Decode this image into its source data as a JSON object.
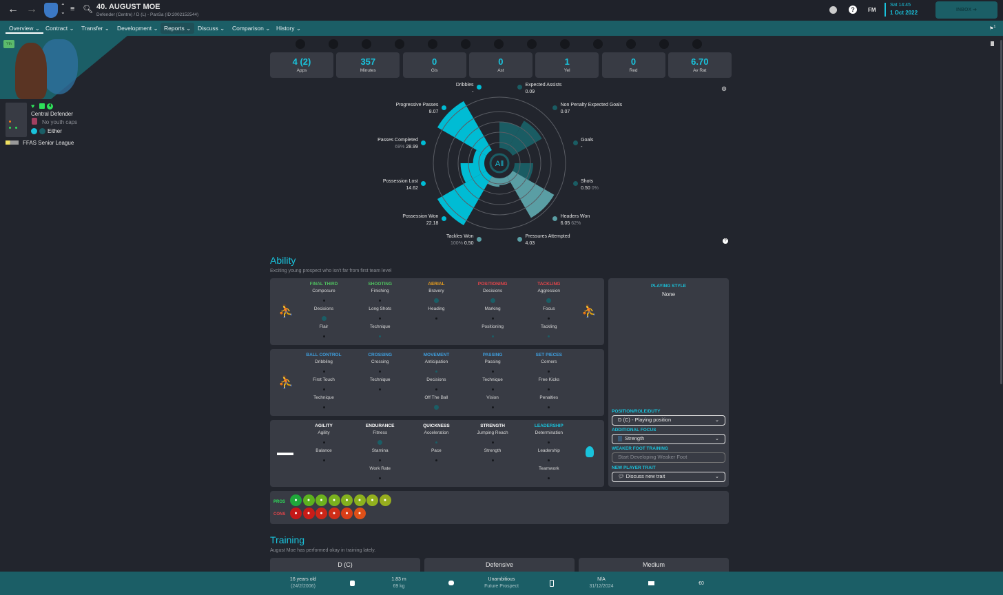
{
  "header": {
    "title": "40. AUGUST MOE",
    "subtitle": "Defender (Centre) / D (L) - PanSa (ID:2002152544)",
    "day_time": "Sat 14:45",
    "date": "1 Oct 2022",
    "inbox": "INBOX",
    "fm": "FM",
    "notif_count": "1"
  },
  "nav": [
    {
      "label": "Overview"
    },
    {
      "label": "Contract"
    },
    {
      "label": "Transfer"
    },
    {
      "label": "Development"
    },
    {
      "label": "Reports"
    },
    {
      "label": "Discuss"
    },
    {
      "label": "Comparison"
    },
    {
      "label": "History"
    }
  ],
  "profile": {
    "badge": "Yth",
    "position": "Central Defender",
    "youth_caps": "No youth caps",
    "foot": "Either",
    "league": "FFAS Senior League",
    "morale_num": "4"
  },
  "stats": [
    {
      "value": "4 (2)",
      "label": "Apps"
    },
    {
      "value": "357",
      "label": "Minutes"
    },
    {
      "value": "0",
      "label": "Gls"
    },
    {
      "value": "0",
      "label": "Ast"
    },
    {
      "value": "1",
      "label": "Yel"
    },
    {
      "value": "0",
      "label": "Red"
    },
    {
      "value": "6.70",
      "label": "Av Rat"
    }
  ],
  "chart_data": {
    "type": "radar-polar",
    "center_label": "All",
    "items": [
      {
        "name": "Dribbles",
        "value": "-",
        "extra": "",
        "level": 0,
        "color": "#00bcd4"
      },
      {
        "name": "Expected Assists",
        "value": "0.09",
        "extra": "",
        "level": 0.47,
        "color": "#1a5c63"
      },
      {
        "name": "Non Penalty Expected Goals",
        "value": "0.07",
        "extra": "",
        "level": 0.6,
        "color": "#1a5c63"
      },
      {
        "name": "Goals",
        "value": "-",
        "extra": "",
        "level": 0,
        "color": "#1a5c63"
      },
      {
        "name": "Shots",
        "value": "0.50",
        "extra": "0%",
        "level": 0.33,
        "color": "#1a5c63"
      },
      {
        "name": "Headers Won",
        "value": "6.05",
        "extra": "62%",
        "level": 0.85,
        "color": "#5a9ea4"
      },
      {
        "name": "Pressures Attempted",
        "value": "4.03",
        "extra": "",
        "level": 0.12,
        "color": "#5a9ea4"
      },
      {
        "name": "Tackles Won",
        "value": "0.50",
        "extra": "100%",
        "level": 0.15,
        "color": "#5a9ea4"
      },
      {
        "name": "Possession Won",
        "value": "22.18",
        "extra": "",
        "level": 1.0,
        "color": "#00bcd4"
      },
      {
        "name": "Possession Lost",
        "value": "14.62",
        "extra": "",
        "level": 0.42,
        "color": "#00bcd4"
      },
      {
        "name": "Passes Completed",
        "value": "28.99",
        "extra": "69%",
        "level": 0.2,
        "color": "#00bcd4"
      },
      {
        "name": "Progressive Passes",
        "value": "8.07",
        "extra": "",
        "level": 1.0,
        "color": "#00bcd4"
      }
    ]
  },
  "ability": {
    "title": "Ability",
    "subtitle": "Exciting young prospect who isn't far from first team level",
    "groups": [
      [
        {
          "h": "FINAL THIRD",
          "c": "#4fc15f",
          "a": [
            "Composure",
            "Decisions",
            "Flair"
          ],
          "d": [
            "s",
            "b",
            "s"
          ]
        },
        {
          "h": "SHOOTING",
          "c": "#4fc15f",
          "a": [
            "Finishing",
            "Long Shots",
            "Technique"
          ],
          "d": [
            "s",
            "s",
            "t"
          ]
        },
        {
          "h": "AERIAL",
          "c": "#f0a21c",
          "a": [
            "Bravery",
            "Heading",
            ""
          ],
          "d": [
            "b",
            "s",
            ""
          ]
        },
        {
          "h": "POSITIONING",
          "c": "#e8454a",
          "a": [
            "Decisions",
            "Marking",
            "Positioning"
          ],
          "d": [
            "b",
            "s",
            "t"
          ]
        },
        {
          "h": "TACKLING",
          "c": "#e8454a",
          "a": [
            "Aggression",
            "Focus",
            "Tackling"
          ],
          "d": [
            "b",
            "s",
            "t"
          ]
        }
      ],
      [
        {
          "h": "BALL CONTROL",
          "c": "#3fa0e0",
          "a": [
            "Dribbling",
            "First Touch",
            "Technique"
          ],
          "d": [
            "s",
            "s",
            "s"
          ]
        },
        {
          "h": "CROSSING",
          "c": "#3fa0e0",
          "a": [
            "Crossing",
            "Technique",
            ""
          ],
          "d": [
            "s",
            "s",
            ""
          ]
        },
        {
          "h": "MOVEMENT",
          "c": "#3fa0e0",
          "a": [
            "Anticipation",
            "Decisions",
            "Off The Ball"
          ],
          "d": [
            "t",
            "s",
            "b"
          ]
        },
        {
          "h": "PASSING",
          "c": "#3fa0e0",
          "a": [
            "Passing",
            "Technique",
            "Vision"
          ],
          "d": [
            "s",
            "s",
            "s"
          ]
        },
        {
          "h": "SET PIECES",
          "c": "#3fa0e0",
          "a": [
            "Corners",
            "Free Kicks",
            "Penalties"
          ],
          "d": [
            "s",
            "s",
            "s"
          ]
        }
      ],
      [
        {
          "h": "AGILITY",
          "c": "#ffffff",
          "a": [
            "Agility",
            "Balance",
            ""
          ],
          "d": [
            "s",
            "s",
            ""
          ]
        },
        {
          "h": "ENDURANCE",
          "c": "#ffffff",
          "a": [
            "Fitness",
            "Stamina",
            "Work Rate"
          ],
          "d": [
            "b",
            "s",
            "s"
          ]
        },
        {
          "h": "QUICKNESS",
          "c": "#ffffff",
          "a": [
            "Acceleration",
            "Pace",
            ""
          ],
          "d": [
            "t",
            "s",
            ""
          ]
        },
        {
          "h": "STRENGTH",
          "c": "#ffffff",
          "a": [
            "Jumping Reach",
            "Strength",
            ""
          ],
          "d": [
            "s",
            "s",
            ""
          ]
        },
        {
          "h": "LEADERSHIP",
          "c": "#19c3dc",
          "a": [
            "Determination",
            "Leadership",
            "Teamwork"
          ],
          "d": [
            "s",
            "s",
            "s"
          ]
        }
      ]
    ]
  },
  "playing_style": {
    "label": "PLAYING STYLE",
    "value": "None"
  },
  "training_opts": {
    "prd_label": "POSITION/ROLE/DUTY",
    "prd_value": "D (C) - Playing position",
    "focus_label": "ADDITIONAL FOCUS",
    "focus_value": "Strength",
    "weak_label": "WEAKER FOOT TRAINING",
    "weak_placeholder": "Start Developing Weaker Foot",
    "trait_label": "NEW PLAYER TRAIT",
    "trait_value": "Discuss new trait"
  },
  "proscons": {
    "pros_label": "PROS",
    "cons_label": "CONS",
    "pros": [
      {
        "icon": "flask-icon",
        "c": "#1fa83a"
      },
      {
        "icon": "net-icon",
        "c": "#5cb21e"
      },
      {
        "icon": "star-icon",
        "c": "#6cb21e"
      },
      {
        "icon": "trend-up-icon",
        "c": "#7ab11e"
      },
      {
        "icon": "chain-icon",
        "c": "#84b11e"
      },
      {
        "icon": "footprint-icon",
        "c": "#8cb11e"
      },
      {
        "icon": "handshake-icon",
        "c": "#92b01e"
      },
      {
        "icon": "happy-cone-icon",
        "c": "#96ad1e"
      }
    ],
    "cons": [
      {
        "icon": "ball-icon",
        "c": "#c41818"
      },
      {
        "icon": "sad-cone-icon",
        "c": "#c81c18"
      },
      {
        "icon": "head-icon",
        "c": "#cc2618"
      },
      {
        "icon": "broken-chain-icon",
        "c": "#d02e18"
      },
      {
        "icon": "target-icon",
        "c": "#d83e18"
      },
      {
        "icon": "cone-gear-icon",
        "c": "#de5018"
      }
    ]
  },
  "training": {
    "title": "Training",
    "subtitle": "August Moe has performed okay in training lately.",
    "boxes": [
      "D (C)",
      "Defensive",
      "Medium"
    ]
  },
  "footer": {
    "age": "16 years old",
    "dob": "(24/2/2006)",
    "height": "1.83 m",
    "weight": "69 kg",
    "personality": "Unambitious",
    "media": "Future Prospect",
    "contract": "N/A",
    "contract_date": "31/12/2024",
    "value": "€0"
  }
}
